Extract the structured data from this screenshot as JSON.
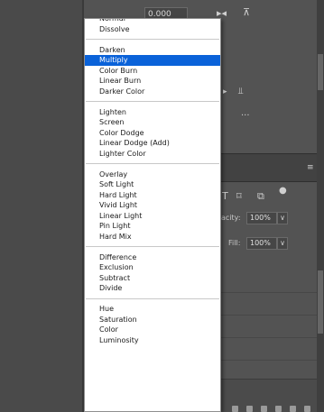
{
  "properties": {
    "top_value": "0.000"
  },
  "layers_panel": {
    "opacity_label": "acity:",
    "opacity_value": "100%",
    "fill_label": "Fill:",
    "fill_value": "100%",
    "more_label": "...",
    "menu_label": "≡"
  },
  "blend_modes": {
    "selected": "Multiply",
    "groups": [
      [
        "Normal",
        "Dissolve"
      ],
      [
        "Darken",
        "Multiply",
        "Color Burn",
        "Linear Burn",
        "Darker Color"
      ],
      [
        "Lighten",
        "Screen",
        "Color Dodge",
        "Linear Dodge (Add)",
        "Lighter Color"
      ],
      [
        "Overlay",
        "Soft Light",
        "Hard Light",
        "Vivid Light",
        "Linear Light",
        "Pin Light",
        "Hard Mix"
      ],
      [
        "Difference",
        "Exclusion",
        "Subtract",
        "Divide"
      ],
      [
        "Hue",
        "Saturation",
        "Color",
        "Luminosity"
      ]
    ]
  }
}
